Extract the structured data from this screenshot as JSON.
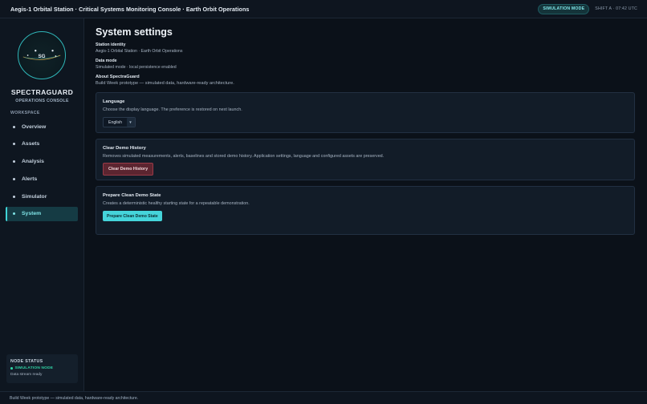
{
  "header": {
    "title": "Aegis-1 Orbital Station · Critical Systems Monitoring Console · Earth Orbit Operations",
    "mode_badge": "SIMULATION MODE",
    "shift": "SHIFT A · 07:42 UTC"
  },
  "sidebar": {
    "logo_text": "SG",
    "brand": "SPECTRAGUARD",
    "subtitle": "OPERATIONS CONSOLE",
    "section_label": "WORKSPACE",
    "items": [
      {
        "label": "Overview"
      },
      {
        "label": "Assets"
      },
      {
        "label": "Analysis"
      },
      {
        "label": "Alerts"
      },
      {
        "label": "Simulator"
      },
      {
        "label": "System"
      }
    ],
    "active_item": "System",
    "node_status": {
      "title": "NODE STATUS",
      "mode": "SIMULATION NODE",
      "detail": "Data stream ready"
    }
  },
  "main": {
    "title": "System settings",
    "station_identity": {
      "label": "Station identity",
      "value": "Aegis-1 Orbital Station · Earth Orbit Operations"
    },
    "data_mode": {
      "label": "Data mode",
      "value": "Simulated mode · local persistence enabled"
    },
    "about": {
      "label": "About SpectraGuard",
      "value": "Build Week prototype — simulated data, hardware-ready architecture."
    },
    "language_card": {
      "title": "Language",
      "description": "Choose the display language. The preference is restored on next launch.",
      "selected": "English"
    },
    "clear_card": {
      "title": "Clear Demo History",
      "description": "Removes simulated measurements, alerts, baselines and stored demo history. Application settings, language and configured assets are preserved.",
      "button": "Clear Demo History"
    },
    "prepare_card": {
      "title": "Prepare Clean Demo State",
      "description": "Creates a deterministic healthy starting state for a repeatable demonstration.",
      "button": "Prepare Clean Demo State"
    }
  },
  "footer": {
    "text": "Build Week prototype — simulated data, hardware-ready architecture."
  },
  "colors": {
    "accent": "#45d4da",
    "danger": "#5c2530",
    "background": "#0b1119",
    "status_ok": "#2fd3a5"
  }
}
